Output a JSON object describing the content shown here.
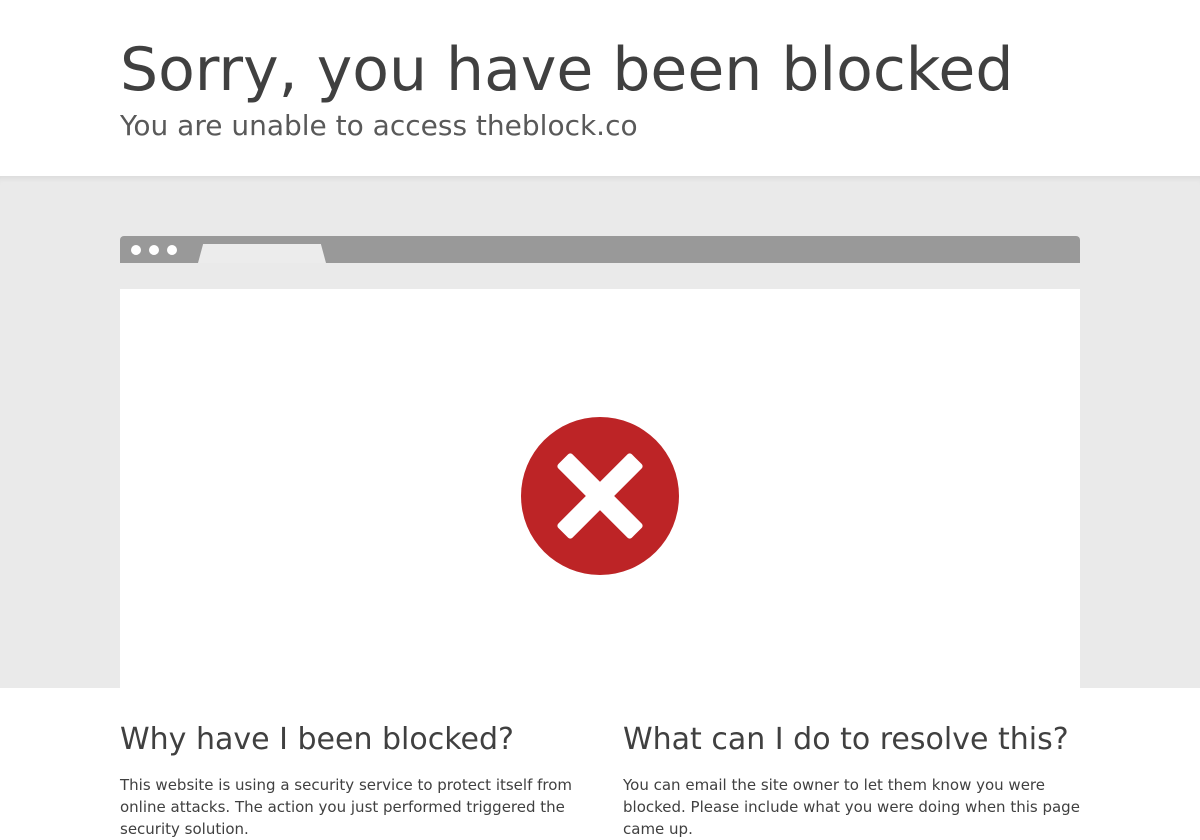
{
  "header": {
    "title": "Sorry, you have been blocked",
    "subtitle": "You are unable to access theblock.co"
  },
  "browser_illustration": {
    "icon": "error-x-circle-icon",
    "icon_color": "#bd2426"
  },
  "sections": {
    "why": {
      "heading": "Why have I been blocked?",
      "body": "This website is using a security service to protect itself from online attacks. The action you just performed triggered the security solution."
    },
    "resolve": {
      "heading": "What can I do to resolve this?",
      "body": "You can email the site owner to let them know you were blocked. Please include what you were doing when this page came up."
    }
  },
  "colors": {
    "band": "#eaeaea",
    "browser_bar": "#999999",
    "text": "#404040"
  }
}
